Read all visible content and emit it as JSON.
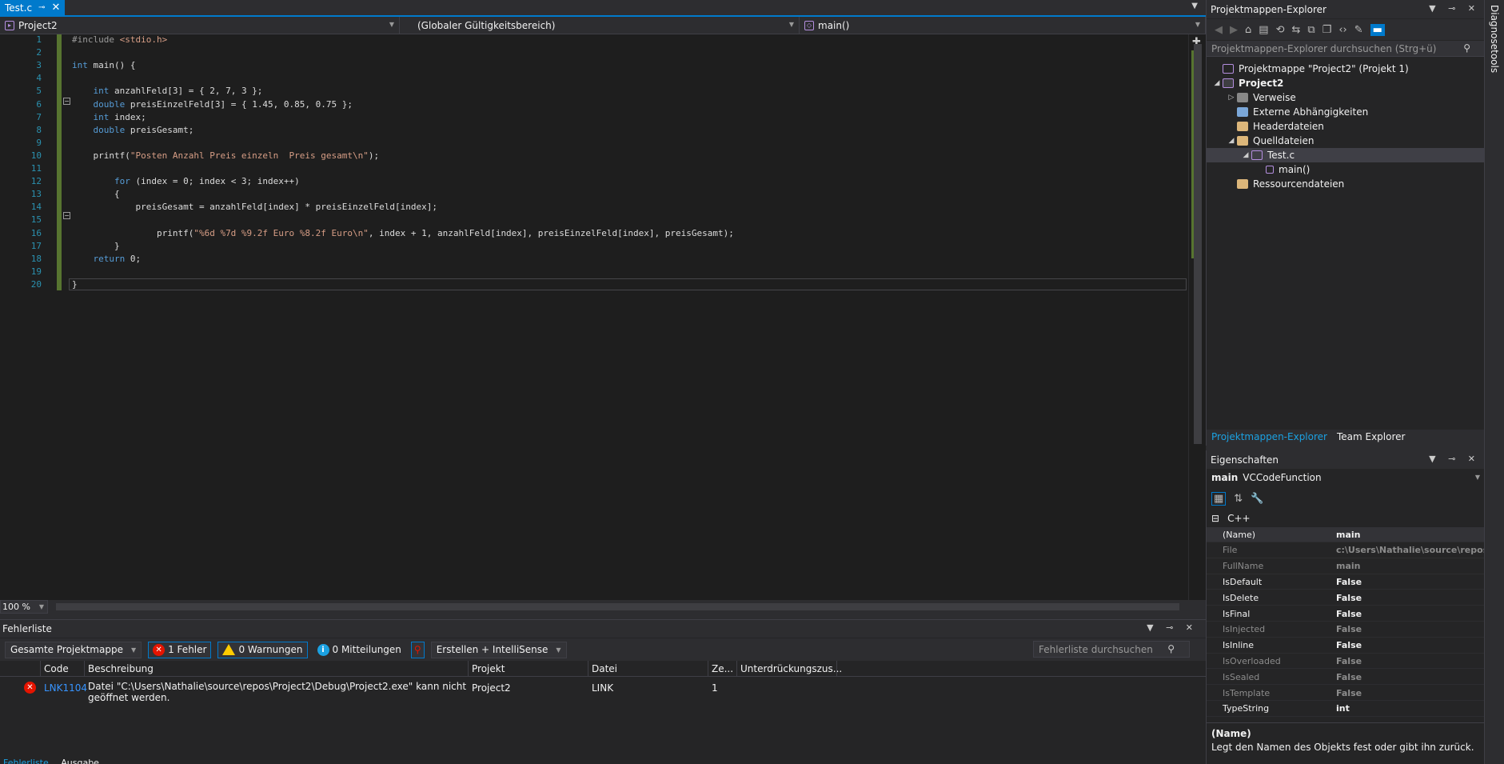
{
  "tabs": [
    {
      "label": "Test.c",
      "active": true
    }
  ],
  "navbar": {
    "project": "Project2",
    "scope": "(Globaler Gültigkeitsbereich)",
    "member": "main()"
  },
  "editor": {
    "line_numbers": [
      "1",
      "2",
      "3",
      "4",
      "5",
      "6",
      "7",
      "8",
      "9",
      "10",
      "11",
      "12",
      "13",
      "14",
      "15",
      "16",
      "17",
      "18",
      "19",
      "20"
    ],
    "lines": [
      "#include <stdio.h>",
      "",
      "int main() {",
      "",
      "    int anzahlFeld[3] = { 2, 7, 3 };",
      "    double preisEinzelFeld[3] = { 1.45, 0.85, 0.75 };",
      "    int index;",
      "    double preisGesamt;",
      "",
      "    printf(\"Posten Anzahl Preis einzeln  Preis gesamt\\n\");",
      "",
      "        for (index = 0; index < 3; index++)",
      "        {",
      "            preisGesamt = anzahlFeld[index] * preisEinzelFeld[index];",
      "",
      "                printf(\"%6d %7d %9.2f Euro %8.2f Euro\\n\", index + 1, anzahlFeld[index], preisEinzelFeld[index], preisGesamt);",
      "        }",
      "    return 0;",
      "",
      "}"
    ],
    "zoom": "100 %"
  },
  "error_list": {
    "title": "Fehlerliste",
    "scope_select": "Gesamte Projektmappe",
    "errors_label": "1 Fehler",
    "warnings_label": "0 Warnungen",
    "messages_label": "0 Mitteilungen",
    "build_select": "Erstellen + IntelliSense",
    "search_placeholder": "Fehlerliste durchsuchen",
    "columns": [
      "Code",
      "Beschreibung",
      "Projekt",
      "Datei",
      "Ze...",
      "Unterdrückungszus..."
    ],
    "rows": [
      {
        "code": "LNK1104",
        "description": "Datei \"C:\\Users\\Nathalie\\source\\repos\\Project2\\Debug\\Project2.exe\" kann nicht geöffnet werden.",
        "project": "Project2",
        "file": "LINK",
        "line": "1",
        "suppression": ""
      }
    ],
    "bottom_tabs": [
      "Fehlerliste",
      "Ausgabe"
    ]
  },
  "solution_explorer": {
    "title": "Projektmappen-Explorer",
    "search_placeholder": "Projektmappen-Explorer durchsuchen (Strg+ü)",
    "tree": [
      {
        "label": "Projektmappe \"Project2\" (Projekt 1)",
        "depth": 0,
        "icon": "solution-icon",
        "expander": ""
      },
      {
        "label": "Project2",
        "depth": 0,
        "icon": "project-icon",
        "expander": "◢",
        "bold": true
      },
      {
        "label": "Verweise",
        "depth": 1,
        "icon": "references-icon",
        "expander": "▷"
      },
      {
        "label": "Externe Abhängigkeiten",
        "depth": 1,
        "icon": "external-deps-icon",
        "expander": ""
      },
      {
        "label": "Headerdateien",
        "depth": 1,
        "icon": "folder-icon",
        "expander": ""
      },
      {
        "label": "Quelldateien",
        "depth": 1,
        "icon": "folder-icon",
        "expander": "◢"
      },
      {
        "label": "Test.c",
        "depth": 2,
        "icon": "c-file-icon",
        "expander": "◢",
        "selected": true
      },
      {
        "label": "main()",
        "depth": 3,
        "icon": "function-icon",
        "expander": ""
      },
      {
        "label": "Ressourcendateien",
        "depth": 1,
        "icon": "folder-icon",
        "expander": ""
      }
    ],
    "bottom_tabs": [
      "Projektmappen-Explorer",
      "Team Explorer"
    ]
  },
  "properties": {
    "title": "Eigenschaften",
    "object_name": "main",
    "object_type": "VCCodeFunction",
    "category": "C++",
    "rows": [
      {
        "key": "(Name)",
        "value": "main",
        "dim": false
      },
      {
        "key": "File",
        "value": "c:\\Users\\Nathalie\\source\\repos",
        "dim": true
      },
      {
        "key": "FullName",
        "value": "main",
        "dim": true
      },
      {
        "key": "IsDefault",
        "value": "False",
        "dim": false
      },
      {
        "key": "IsDelete",
        "value": "False",
        "dim": false
      },
      {
        "key": "IsFinal",
        "value": "False",
        "dim": false
      },
      {
        "key": "IsInjected",
        "value": "False",
        "dim": true
      },
      {
        "key": "IsInline",
        "value": "False",
        "dim": false
      },
      {
        "key": "IsOverloaded",
        "value": "False",
        "dim": true
      },
      {
        "key": "IsSealed",
        "value": "False",
        "dim": true
      },
      {
        "key": "IsTemplate",
        "value": "False",
        "dim": true
      },
      {
        "key": "TypeString",
        "value": "int",
        "dim": false
      }
    ],
    "desc_title": "(Name)",
    "desc_text": "Legt den Namen des Objekts fest oder gibt ihn zurück."
  },
  "side_strip": {
    "label": "Diagnosetools"
  }
}
